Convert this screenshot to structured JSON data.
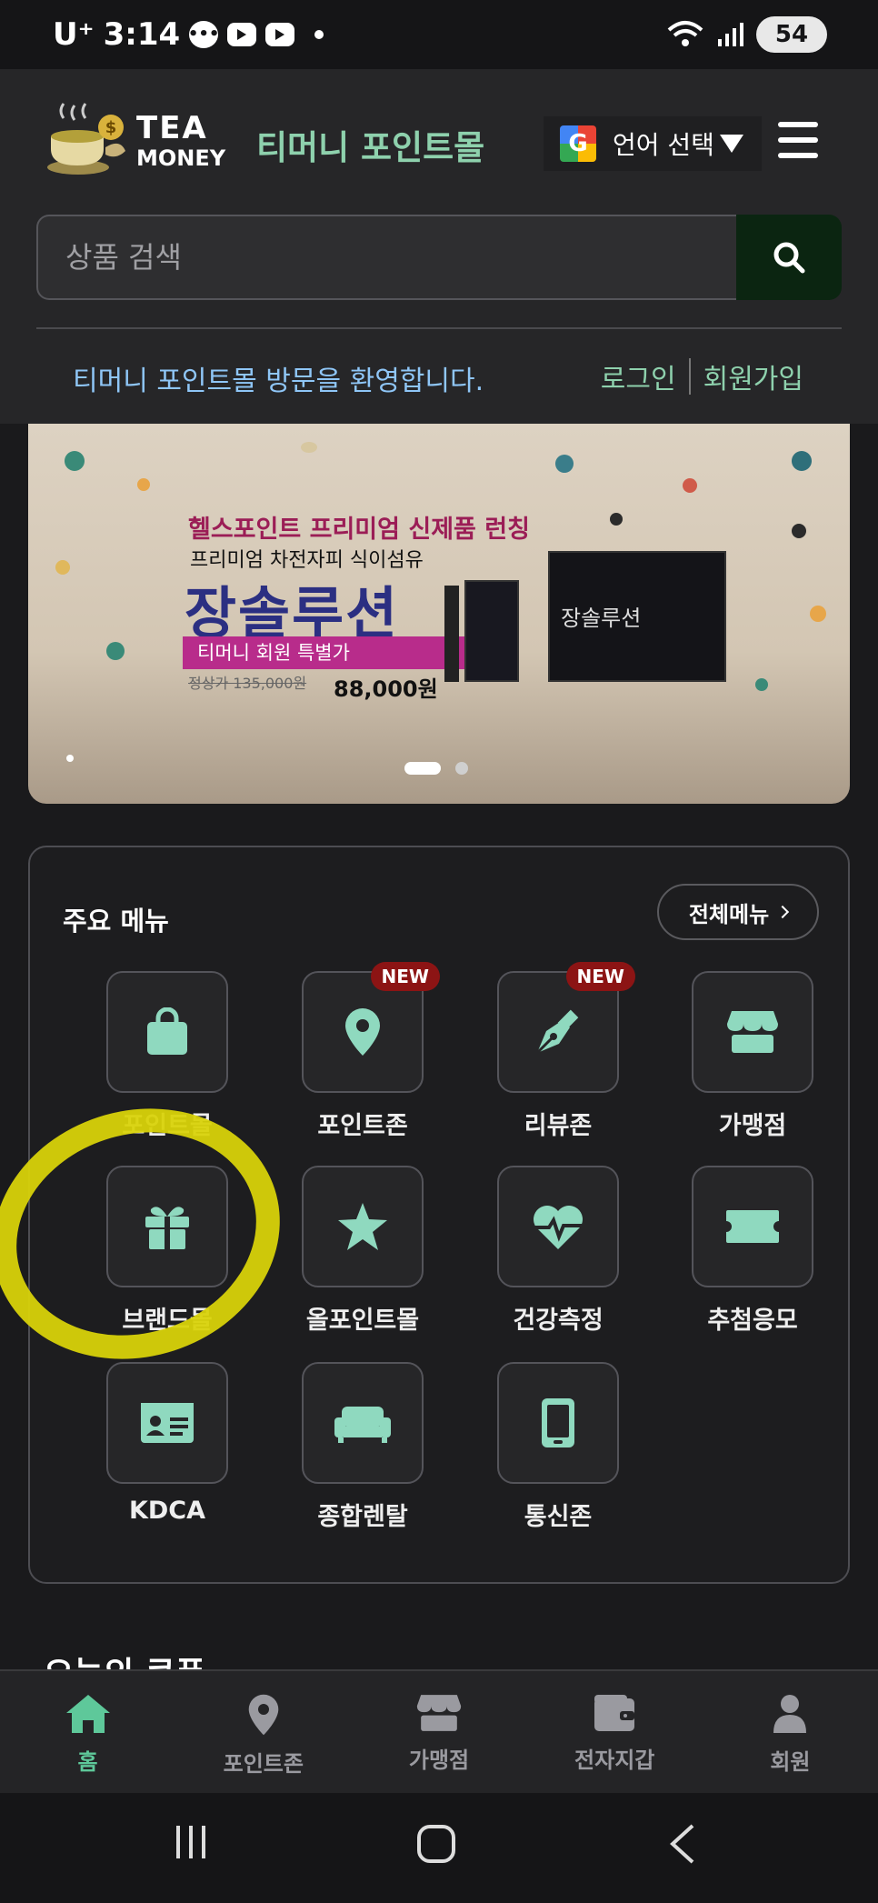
{
  "status_bar": {
    "carrier": "U⁺",
    "time": "3:14",
    "battery": "54"
  },
  "header": {
    "logo_line1": "TEA",
    "logo_line2": "MONEY",
    "mall_title": "티머니 포인트몰",
    "language_label": "언어 선택",
    "search_placeholder": "상품 검색",
    "welcome": "티머니 포인트몰 방문을 환영합니다.",
    "login": "로그인",
    "signup": "회원가입"
  },
  "banner": {
    "line1": "헬스포인트 프리미엄 신제품 런칭",
    "line2": "프리미엄 차전자피 식이섬유",
    "product_name": "장솔루션",
    "member_price_label": "티머니 회원 특별가",
    "original_price": "정상가 135,000원",
    "sale_price": "88,000원",
    "box_name": "장솔루션",
    "slide_count": 2,
    "active_slide": 1
  },
  "main_menu": {
    "title": "주요 메뉴",
    "all_menu": "전체메뉴",
    "new_badge": "NEW",
    "items": [
      {
        "label": "포인트몰",
        "icon": "shopping-bag-icon",
        "is_new": false
      },
      {
        "label": "포인트존",
        "icon": "map-pin-icon",
        "is_new": true
      },
      {
        "label": "리뷰존",
        "icon": "pen-nib-icon",
        "is_new": true
      },
      {
        "label": "가맹점",
        "icon": "store-icon",
        "is_new": false
      },
      {
        "label": "브랜드몰",
        "icon": "gift-icon",
        "is_new": false
      },
      {
        "label": "올포인트몰",
        "icon": "star-icon",
        "is_new": false
      },
      {
        "label": "건강측정",
        "icon": "heart-pulse-icon",
        "is_new": false
      },
      {
        "label": "추첨응모",
        "icon": "ticket-icon",
        "is_new": false
      },
      {
        "label": "KDCA",
        "icon": "id-card-icon",
        "is_new": false
      },
      {
        "label": "종합렌탈",
        "icon": "sofa-icon",
        "is_new": false
      },
      {
        "label": "통신존",
        "icon": "mobile-phone-icon",
        "is_new": false
      }
    ]
  },
  "next_section_peek": "오늘의 쿠폰",
  "bottom_nav": {
    "items": [
      {
        "label": "홈",
        "icon": "home-icon",
        "active": true
      },
      {
        "label": "포인트존",
        "icon": "map-pin-icon",
        "active": false
      },
      {
        "label": "가맹점",
        "icon": "store-icon",
        "active": false
      },
      {
        "label": "전자지갑",
        "icon": "wallet-icon",
        "active": false
      },
      {
        "label": "회원",
        "icon": "user-icon",
        "active": false
      }
    ]
  },
  "colors": {
    "accent_green": "#8ed1ad",
    "icon_mint": "#8fd9bf",
    "welcome_blue": "#8fc6f7",
    "new_badge_red": "#8c1414",
    "highlight_yellow": "#d8d20a"
  }
}
